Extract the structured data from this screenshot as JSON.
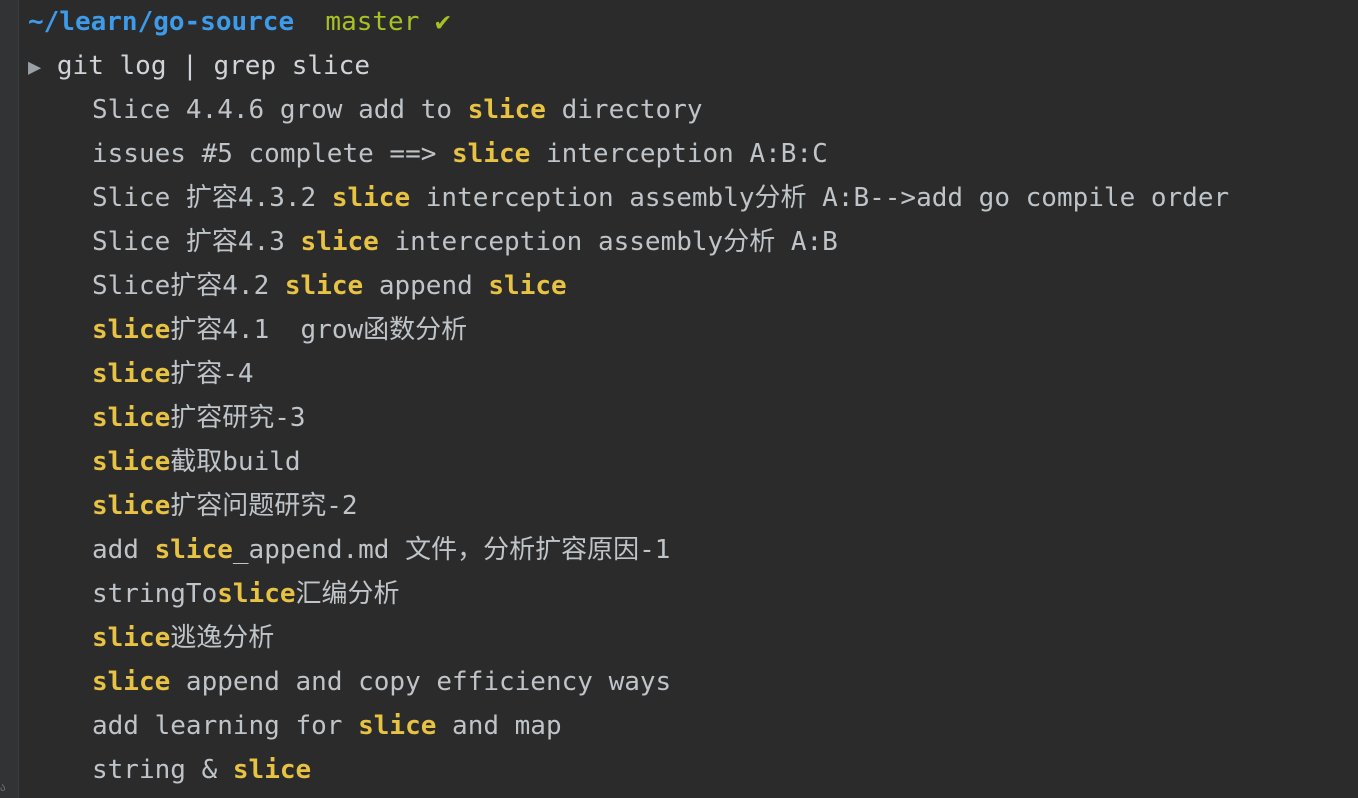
{
  "prompt": {
    "path": "~/learn/go-source",
    "branch": "master",
    "status_glyph": "✔",
    "arrow": "▶",
    "command": "git log | grep slice"
  },
  "output_lines": [
    [
      {
        "t": "Slice 4.4.6 grow add to ",
        "m": false
      },
      {
        "t": "slice",
        "m": true
      },
      {
        "t": " directory",
        "m": false
      }
    ],
    [
      {
        "t": "issues #5 complete ==> ",
        "m": false
      },
      {
        "t": "slice",
        "m": true
      },
      {
        "t": " interception A:B:C",
        "m": false
      }
    ],
    [
      {
        "t": "Slice 扩容4.3.2 ",
        "m": false
      },
      {
        "t": "slice",
        "m": true
      },
      {
        "t": " interception assembly分析 A:B-->add go compile order",
        "m": false
      }
    ],
    [
      {
        "t": "Slice 扩容4.3 ",
        "m": false
      },
      {
        "t": "slice",
        "m": true
      },
      {
        "t": " interception assembly分析 A:B",
        "m": false
      }
    ],
    [
      {
        "t": "Slice扩容4.2 ",
        "m": false
      },
      {
        "t": "slice",
        "m": true
      },
      {
        "t": " append ",
        "m": false
      },
      {
        "t": "slice",
        "m": true
      }
    ],
    [
      {
        "t": "slice",
        "m": true
      },
      {
        "t": "扩容4.1  grow函数分析",
        "m": false
      }
    ],
    [
      {
        "t": "slice",
        "m": true
      },
      {
        "t": "扩容-4",
        "m": false
      }
    ],
    [
      {
        "t": "slice",
        "m": true
      },
      {
        "t": "扩容研究-3",
        "m": false
      }
    ],
    [
      {
        "t": "slice",
        "m": true
      },
      {
        "t": "截取build",
        "m": false
      }
    ],
    [
      {
        "t": "slice",
        "m": true
      },
      {
        "t": "扩容问题研究-2",
        "m": false
      }
    ],
    [
      {
        "t": "add ",
        "m": false
      },
      {
        "t": "slice",
        "m": true
      },
      {
        "t": "_append.md 文件，分析扩容原因-1",
        "m": false
      }
    ],
    [
      {
        "t": "stringTo",
        "m": false
      },
      {
        "t": "slice",
        "m": true
      },
      {
        "t": "汇编分析",
        "m": false
      }
    ],
    [
      {
        "t": "slice",
        "m": true
      },
      {
        "t": "逃逸分析",
        "m": false
      }
    ],
    [
      {
        "t": "slice",
        "m": true
      },
      {
        "t": " append and copy efficiency ways",
        "m": false
      }
    ],
    [
      {
        "t": "add learning for ",
        "m": false
      },
      {
        "t": "slice",
        "m": true
      },
      {
        "t": " and map",
        "m": false
      }
    ],
    [
      {
        "t": "string & ",
        "m": false
      },
      {
        "t": "slice",
        "m": true
      }
    ]
  ],
  "gutter_mark": "ა",
  "colors": {
    "background": "#2b2b2b",
    "path": "#3d9be9",
    "branch": "#a8c023",
    "text": "#bfc4c9",
    "match": "#e8c343"
  }
}
